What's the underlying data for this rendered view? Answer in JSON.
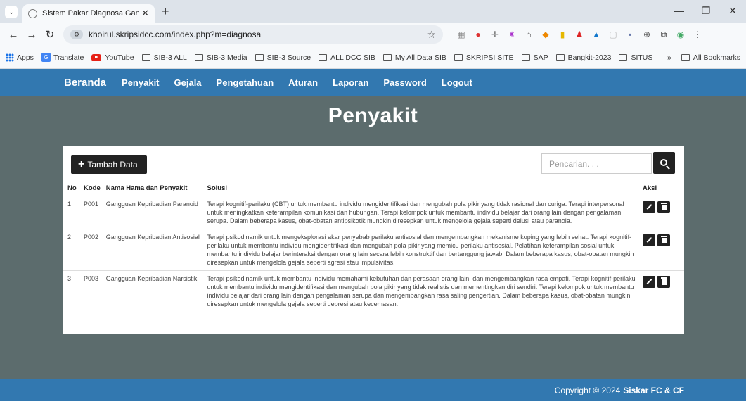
{
  "browser": {
    "tab_title": "Sistem Pakar Diagnosa Ganggu",
    "url": "khoirul.skripsidcc.com/index.php?m=diagnosa",
    "bookmarks": [
      "Apps",
      "Translate",
      "YouTube",
      "SIB-3 ALL",
      "SIB-3 Media",
      "SIB-3 Source",
      "ALL DCC SIB",
      "My All Data SIB",
      "SKRIPSI SITE",
      "SAP",
      "Bangkit-2023",
      "SITUS"
    ],
    "all_bookmarks": "All Bookmarks",
    "more": "»"
  },
  "nav": {
    "brand": "Beranda",
    "items": [
      "Penyakit",
      "Gejala",
      "Pengetahuan",
      "Aturan",
      "Laporan",
      "Password",
      "Logout"
    ]
  },
  "page": {
    "title": "Penyakit",
    "add_button": "Tambah Data",
    "search_placeholder": "Pencarian. . ."
  },
  "table": {
    "headers": [
      "No",
      "Kode",
      "Nama Hama dan Penyakit",
      "Solusi",
      "Aksi"
    ],
    "rows": [
      {
        "no": "1",
        "kode": "P001",
        "nama": "Gangguan Kepribadian Paranoid",
        "solusi": "Terapi kognitif-perilaku (CBT) untuk membantu individu mengidentifikasi dan mengubah pola pikir yang tidak rasional dan curiga. Terapi interpersonal untuk meningkatkan keterampilan komunikasi dan hubungan. Terapi kelompok untuk membantu individu belajar dari orang lain dengan pengalaman serupa. Dalam beberapa kasus, obat-obatan antipsikotik mungkin diresepkan untuk mengelola gejala seperti delusi atau paranoia."
      },
      {
        "no": "2",
        "kode": "P002",
        "nama": "Gangguan Kepribadian Antisosial",
        "solusi": "Terapi psikodinamik untuk mengeksplorasi akar penyebab perilaku antisosial dan mengembangkan mekanisme koping yang lebih sehat. Terapi kognitif-perilaku untuk membantu individu mengidentifikasi dan mengubah pola pikir yang memicu perilaku antisosial. Pelatihan keterampilan sosial untuk membantu individu belajar berinteraksi dengan orang lain secara lebih konstruktif dan bertanggung jawab. Dalam beberapa kasus, obat-obatan mungkin diresepkan untuk mengelola gejala seperti agresi atau impulsivitas."
      },
      {
        "no": "3",
        "kode": "P003",
        "nama": "Gangguan Kepribadian Narsistik",
        "solusi": "Terapi psikodinamik untuk membantu individu memahami kebutuhan dan perasaan orang lain, dan mengembangkan rasa empati. Terapi kognitif-perilaku untuk membantu individu mengidentifikasi dan mengubah pola pikir yang tidak realistis dan mementingkan diri sendiri. Terapi kelompok untuk membantu individu belajar dari orang lain dengan pengalaman serupa dan mengembangkan rasa saling pengertian. Dalam beberapa kasus, obat-obatan mungkin diresepkan untuk mengelola gejala seperti depresi atau kecemasan."
      }
    ]
  },
  "footer": {
    "text": "Copyright © 2024",
    "brand": "Siskar FC & CF"
  }
}
